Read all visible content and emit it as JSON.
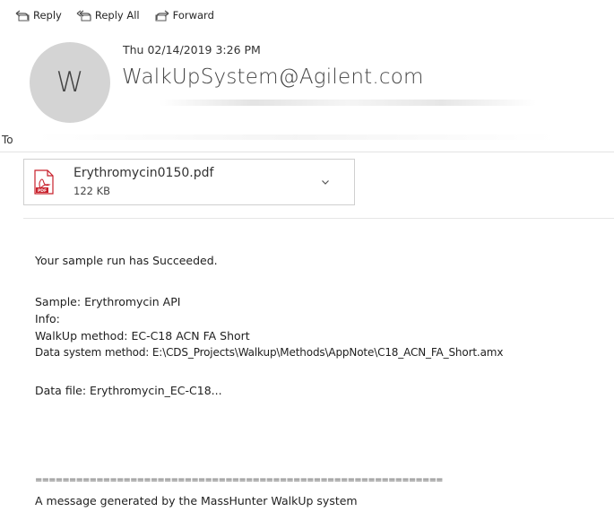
{
  "toolbar": {
    "reply": "Reply",
    "reply_all": "Reply All",
    "forward": "Forward"
  },
  "header": {
    "avatar_initial": "W",
    "date": "Thu 02/14/2019 3:26 PM",
    "sender": "WalkUpSystem@Agilent.com",
    "to_label": "To"
  },
  "attachment": {
    "name": "Erythromycin0150.pdf",
    "size": "122 KB",
    "icon": "pdf-file-icon",
    "icon_label": "PDF"
  },
  "body": {
    "status_line": "Your sample run has Succeeded.",
    "sample_label": "Sample:",
    "sample_value": "Erythromycin API",
    "info_label": "Info:",
    "method_line": "WalkUp method: EC-C18 ACN FA Short",
    "data_system_line": "Data system method: E:\\CDS_Projects\\Walkup\\Methods\\AppNote\\C18_ACN_FA_Short.amx",
    "data_file_line": "Data file: Erythromycin_EC-C18...",
    "separator": "============================================================",
    "footer_line": "A message generated by the MassHunter WalkUp system"
  },
  "colors": {
    "pdf_red": "#c8202b",
    "toolbar_icon": "#555555",
    "avatar_bg": "#d4d4d4"
  }
}
